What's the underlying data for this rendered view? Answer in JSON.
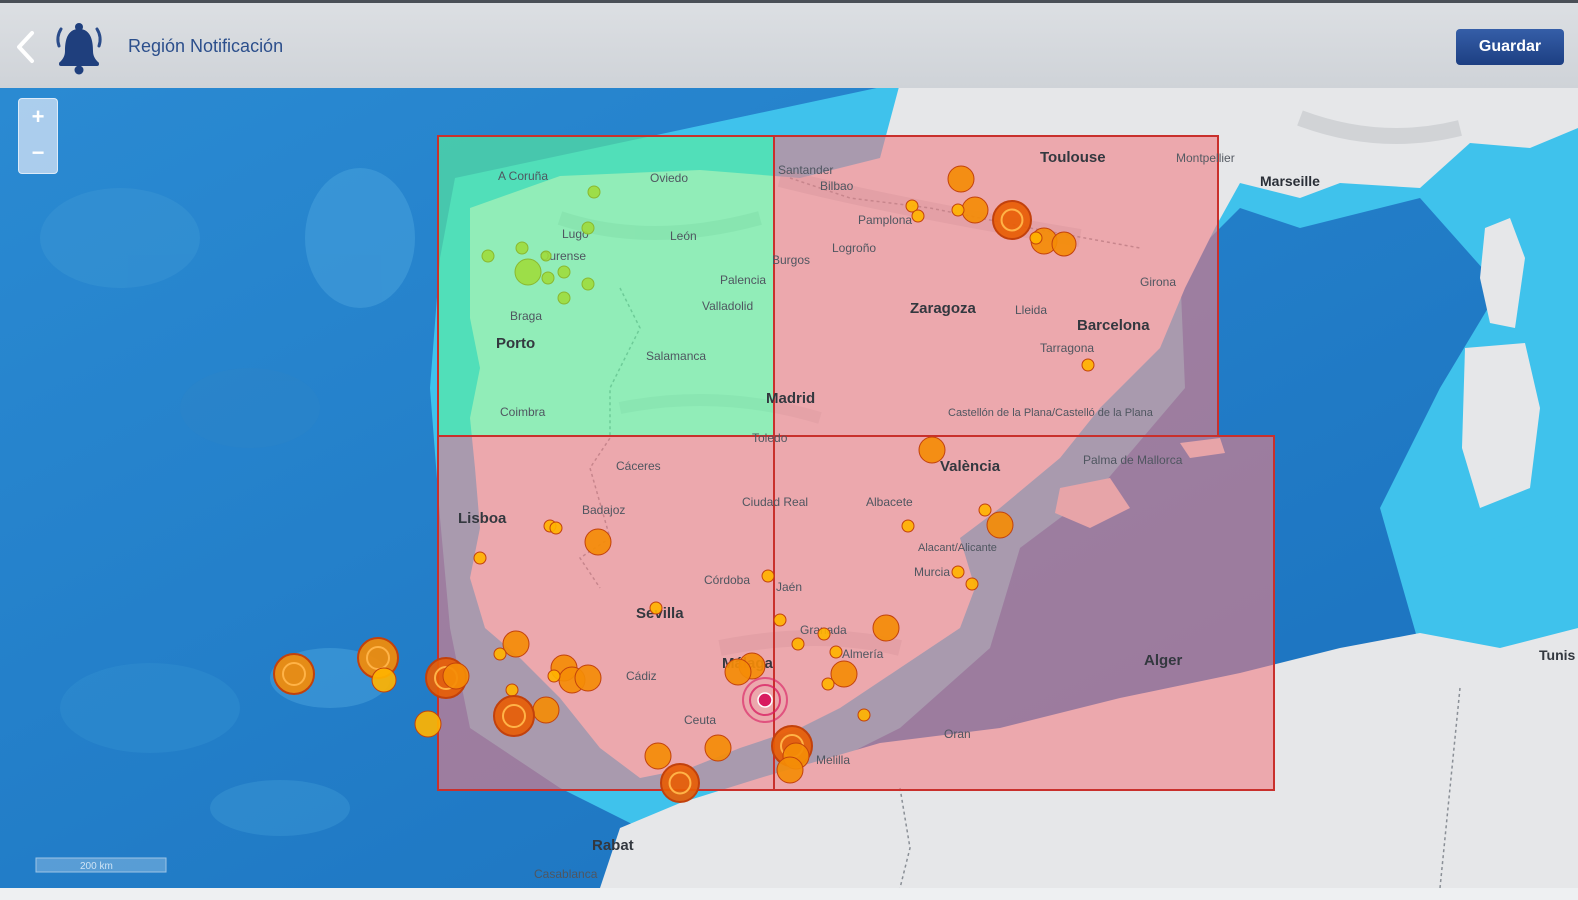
{
  "header": {
    "title": "Región Notificación",
    "save_label": "Guardar",
    "back_icon": "chevron-left-icon",
    "bell_icon": "bell-notification-icon"
  },
  "map": {
    "zoom_in": "+",
    "zoom_out": "−",
    "scale_label": "200 km",
    "colors": {
      "water_deep": "#1e7cc8",
      "water_shelf": "#3ec3ec",
      "land": "#e4e6e8",
      "region_selected": "#5cf09a",
      "region_unselected": "#f07e86",
      "region_border": "#c9302c",
      "quake_small": "#ffb300",
      "quake_medium": "#f48c06",
      "quake_large": "#e85d04",
      "quake_selected": "#9edc3c",
      "epicenter": "#d81b60"
    },
    "regions": [
      {
        "name": "noroeste",
        "state": "selected"
      },
      {
        "name": "noreste",
        "state": "unselected"
      },
      {
        "name": "suroeste",
        "state": "unselected"
      },
      {
        "name": "sureste",
        "state": "unselected"
      }
    ],
    "labels": {
      "toulouse": "Toulouse",
      "montpellier": "Montpellier",
      "marseille": "Marseille",
      "acoruna": "A Coruña",
      "oviedo": "Oviedo",
      "santander": "Santander",
      "bilbao": "Bilbao",
      "pamplona": "Pamplona",
      "lugo": "Lugo",
      "leon": "León",
      "ourense": "Ourense",
      "burgos": "Burgos",
      "logrono": "Logroño",
      "palencia": "Palencia",
      "valladolid": "Valladolid",
      "zaragoza": "Zaragoza",
      "lleida": "Lleida",
      "girona": "Girona",
      "barcelona": "Barcelona",
      "tarragona": "Tarragona",
      "braga": "Braga",
      "porto": "Porto",
      "salamanca": "Salamanca",
      "madrid": "Madrid",
      "coimbra": "Coimbra",
      "castellon": "Castellón de la Plana/Castelló de la Plana",
      "toledo": "Toledo",
      "caceres": "Cáceres",
      "valencia": "València",
      "palma": "Palma de Mallorca",
      "lisboa": "Lisboa",
      "badajoz": "Badajoz",
      "ciudadreal": "Ciudad Real",
      "albacete": "Albacete",
      "alicante": "Alacant/Alicante",
      "murcia": "Murcia",
      "cordoba": "Córdoba",
      "jaen": "Jaén",
      "sevilla": "Sevilla",
      "granada": "Granada",
      "almeria": "Almería",
      "malaga": "Málaga",
      "cadiz": "Cádiz",
      "alger": "Alger",
      "ceuta": "Ceuta",
      "oran": "Oran",
      "melilla": "Melilla",
      "rabat": "Rabat",
      "casablanca": "Casablanca",
      "tunis": "Tunis"
    }
  }
}
